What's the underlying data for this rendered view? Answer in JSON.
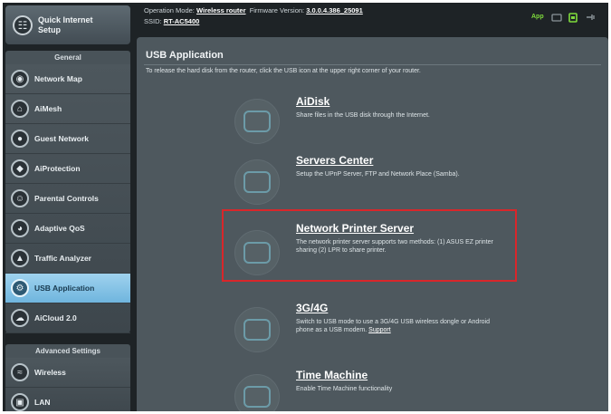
{
  "sidebar": {
    "quick_setup": {
      "label": "Quick Internet Setup",
      "icon": "router-icon"
    },
    "general_header": "General",
    "general_items": [
      {
        "label": "Network Map",
        "icon": "globe-icon"
      },
      {
        "label": "AiMesh",
        "icon": "house-icon"
      },
      {
        "label": "Guest Network",
        "icon": "guest-icon"
      },
      {
        "label": "AiProtection",
        "icon": "shield-icon"
      },
      {
        "label": "Parental Controls",
        "icon": "family-icon"
      },
      {
        "label": "Adaptive QoS",
        "icon": "gauge-icon"
      },
      {
        "label": "Traffic Analyzer",
        "icon": "chart-icon"
      },
      {
        "label": "USB Application",
        "icon": "usb-icon",
        "active": true
      },
      {
        "label": "AiCloud 2.0",
        "icon": "cloud-icon"
      }
    ],
    "advanced_header": "Advanced Settings",
    "advanced_items": [
      {
        "label": "Wireless",
        "icon": "wifi-icon"
      },
      {
        "label": "LAN",
        "icon": "lan-icon"
      }
    ]
  },
  "topbar": {
    "mode_label": "Operation Mode:",
    "mode_value": "Wireless router",
    "firmware_label": "Firmware Version:",
    "firmware_value": "3.0.0.4.386_25091",
    "ssid_label": "SSID:",
    "ssid_value": "RT-AC5400",
    "app_label": "App",
    "accent": "#7fdb3c"
  },
  "main": {
    "title": "USB Application",
    "description": "To release the hard disk from the router, click the USB icon at the upper right corner of your router.",
    "apps": [
      {
        "name": "AiDisk",
        "desc": "Share files in the USB disk through the Internet.",
        "icon": "cloud-disk-icon"
      },
      {
        "name": "Servers Center",
        "desc": "Setup the UPnP Server, FTP and Network Place (Samba).",
        "icon": "server-icon"
      },
      {
        "name": "Network Printer Server",
        "desc": "The network printer server supports two methods: (1) ASUS EZ printer sharing (2) LPR to share printer.",
        "icon": "printer-icon"
      },
      {
        "name": "3G/4G",
        "desc": "Switch to USB mode to use a 3G/4G USB wireless dongle or Android phone as a USB modem.",
        "link": "Support",
        "icon": "modem-icon"
      },
      {
        "name": "Time Machine",
        "desc": "Enable Time Machine functionality",
        "icon": "clock-icon"
      }
    ],
    "highlight_color": "#d9262a"
  }
}
